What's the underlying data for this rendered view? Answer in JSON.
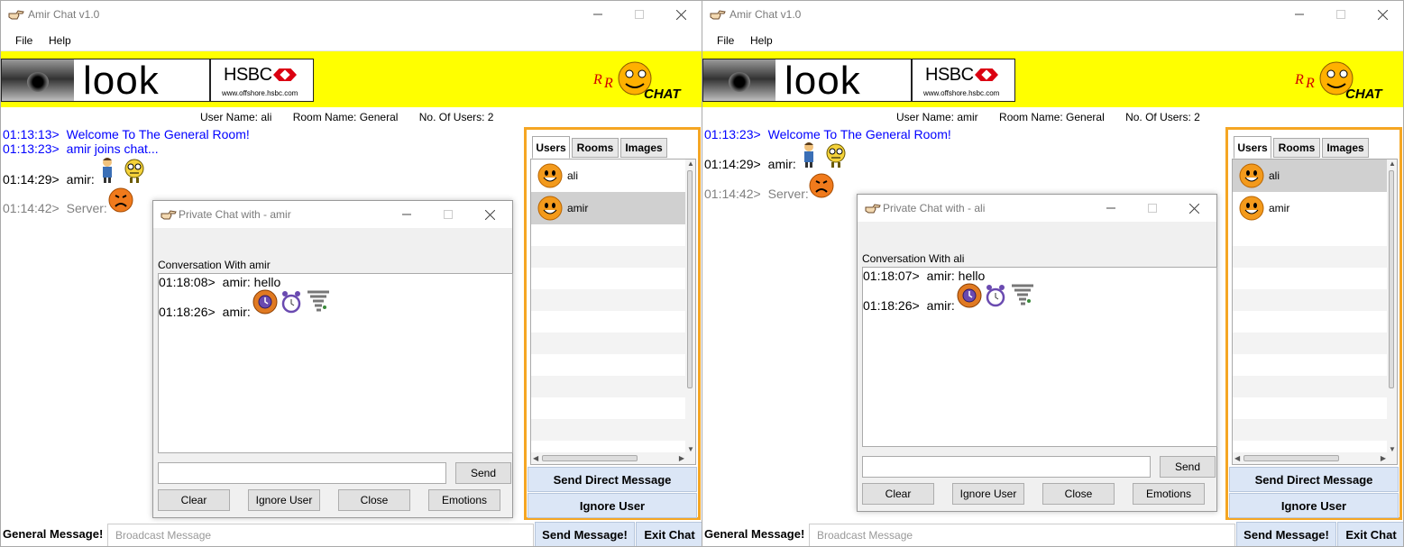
{
  "windows": [
    {
      "title": "Amir Chat v1.0",
      "menu": [
        "File",
        "Help"
      ],
      "ads": {
        "look_text": "look",
        "hsbc_brand": "HSBC",
        "hsbc_url": "www.offshore.hsbc.com"
      },
      "logo_text": "CHAT",
      "info": {
        "user_name": "User Name: ali",
        "room_name": "Room Name: General",
        "user_count": "No. Of Users: 2"
      },
      "messages": [
        {
          "time": "01:13:13>",
          "text": "Welcome To The General Room!"
        },
        {
          "time": "01:13:23>",
          "text": "amir joins chat..."
        },
        {
          "time": "01:14:29>",
          "text": "amir:"
        },
        {
          "time": "01:14:42>",
          "text": "Server:"
        }
      ],
      "tabs": [
        "Users",
        "Rooms",
        "Images"
      ],
      "users": [
        {
          "name": "ali"
        },
        {
          "name": "amir",
          "selected": true
        }
      ],
      "send_direct_label": "Send Direct Message",
      "ignore_label": "Ignore User",
      "general_label": "General Message!",
      "broadcast_placeholder": "Broadcast Message",
      "send_message_label": "Send Message!",
      "exit_label": "Exit Chat",
      "private": {
        "title": "Private Chat with - amir",
        "conversation_label": "Conversation With amir",
        "messages": [
          {
            "time": "01:18:08>",
            "text": "amir: hello"
          },
          {
            "time": "01:18:26>",
            "text": "amir:"
          }
        ],
        "send_label": "Send",
        "buttons": [
          "Clear",
          "Ignore User",
          "Close",
          "Emotions"
        ]
      }
    },
    {
      "title": "Amir Chat v1.0",
      "menu": [
        "File",
        "Help"
      ],
      "ads": {
        "look_text": "look",
        "hsbc_brand": "HSBC",
        "hsbc_url": "www.offshore.hsbc.com"
      },
      "logo_text": "CHAT",
      "info": {
        "user_name": "User Name: amir",
        "room_name": "Room Name: General",
        "user_count": "No. Of Users: 2"
      },
      "messages": [
        {
          "time": "01:13:23>",
          "text": "Welcome To The General Room!"
        },
        {
          "time": "01:14:29>",
          "text": "amir:"
        },
        {
          "time": "01:14:42>",
          "text": "Server:"
        }
      ],
      "tabs": [
        "Users",
        "Rooms",
        "Images"
      ],
      "users": [
        {
          "name": "ali",
          "selected": true
        },
        {
          "name": "amir"
        }
      ],
      "send_direct_label": "Send Direct Message",
      "ignore_label": "Ignore User",
      "general_label": "General Message!",
      "broadcast_placeholder": "Broadcast Message",
      "send_message_label": "Send Message!",
      "exit_label": "Exit Chat",
      "private": {
        "title": "Private Chat with - ali",
        "conversation_label": "Conversation With ali",
        "messages": [
          {
            "time": "01:18:07>",
            "text": "amir: hello"
          },
          {
            "time": "01:18:26>",
            "text": "amir:"
          }
        ],
        "send_label": "Send",
        "buttons": [
          "Clear",
          "Ignore User",
          "Close",
          "Emotions"
        ]
      }
    }
  ],
  "colors": {
    "banner": "#ffff00",
    "panel_border": "#f5a623",
    "button_blue": "#dbe6f6",
    "message_blue": "#0000ff",
    "message_gray": "#808080"
  },
  "icons": [
    "pointing-hand-icon",
    "minimize-icon",
    "maximize-icon",
    "close-icon",
    "smiley-face-icon",
    "sad-face-icon",
    "alarm-clock-icon",
    "tornado-icon"
  ]
}
